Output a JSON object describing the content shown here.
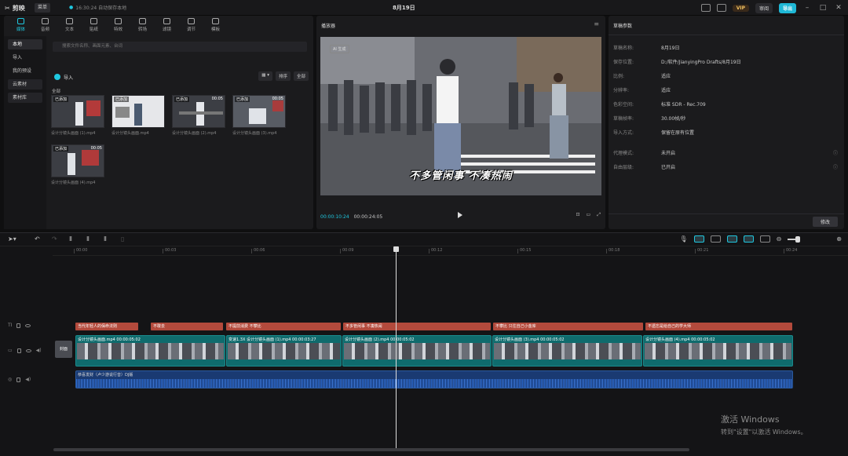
{
  "app": {
    "logo_text": "剪映",
    "menu_label": "菜单",
    "save_status": "16:30:24 自动保存本地",
    "title": "8月19日",
    "vip": "VIP",
    "review": "审阅",
    "export": "导出"
  },
  "media_tabs": [
    "媒体",
    "音频",
    "文本",
    "贴纸",
    "特效",
    "转场",
    "滤镜",
    "调节",
    "模板"
  ],
  "sidebar": {
    "items": [
      "本地",
      "导入",
      "我的预设",
      "云素材",
      "素材库"
    ]
  },
  "media": {
    "search_placeholder": "搜索文件名称、画面元素、台词",
    "import_label": "导入",
    "sort_label": "排序",
    "filter_label": "全部",
    "all_label": "全部",
    "clips": [
      {
        "badge": "已添加",
        "name": "设计分镜头画面 (1).mp4",
        "duration": ""
      },
      {
        "badge": "已添加",
        "name": "设计分镜头画面.mp4",
        "duration": ""
      },
      {
        "badge": "已添加",
        "name": "设计分镜头画面 (2).mp4",
        "duration": "00:05"
      },
      {
        "badge": "已添加",
        "name": "设计分镜头画面 (3).mp4",
        "duration": "00:05"
      },
      {
        "badge": "已添加",
        "name": "设计分镜头画面 (4).mp4",
        "duration": "00:05"
      }
    ]
  },
  "player": {
    "title": "播放器",
    "ai_badge": "AI 生成",
    "subtitle": "不多管闲事  不凑热闹",
    "current_time": "00:00:10:24",
    "total_time": "00:00:24:05"
  },
  "params": {
    "title": "草稿参数",
    "rows": [
      {
        "k": "草稿名称:",
        "v": "8月19日"
      },
      {
        "k": "保存位置:",
        "v": "D:/软件/JianyingPro Drafts/8月19日"
      },
      {
        "k": "比例:",
        "v": "适应"
      },
      {
        "k": "分辨率:",
        "v": "适应"
      },
      {
        "k": "色彩空间:",
        "v": "标准 SDR - Rec.709"
      },
      {
        "k": "草稿帧率:",
        "v": "30.00帧/秒"
      },
      {
        "k": "导入方式:",
        "v": "保留在原有位置"
      },
      {
        "k": "代理模式:",
        "v": "未开启"
      },
      {
        "k": "自由层级:",
        "v": "已开启"
      }
    ],
    "modify_label": "修改"
  },
  "timeline": {
    "ticks": [
      "00:00",
      "00:03",
      "00:06",
      "00:09",
      "00:12",
      "00:15",
      "00:18",
      "00:21",
      "00:24"
    ],
    "cover_label": "封面",
    "text_clips": [
      "当代年轻人的保命法则",
      "不敢去",
      "不提前消费 不攀比",
      "不多管闲事 不凑热闹",
      "不攀比 只往自己小金库",
      "不遗忘是给自己的学大师"
    ],
    "video_clips": [
      "设计分镜头画面.mp4  00:00:05:02",
      "变速1.3X  设计分镜头画面 (1).mp4  00:00:03:27",
      "设计分镜头画面 (2).mp4  00:00:05:02",
      "设计分镜头画面 (3).mp4  00:00:05:02",
      "设计分镜头画面 (4).mp4  00:00:05:02"
    ],
    "audio_clip": "恭喜发财（卢少游说行音）DJ版"
  },
  "watermark": {
    "line1": "激活 Windows",
    "line2": "转到\"设置\"以激活 Windows。"
  },
  "colors": {
    "accent": "#1fc8e0",
    "text_track": "#b34a3c",
    "video_track": "#0f6b6d",
    "audio_track": "#1a3a72"
  }
}
